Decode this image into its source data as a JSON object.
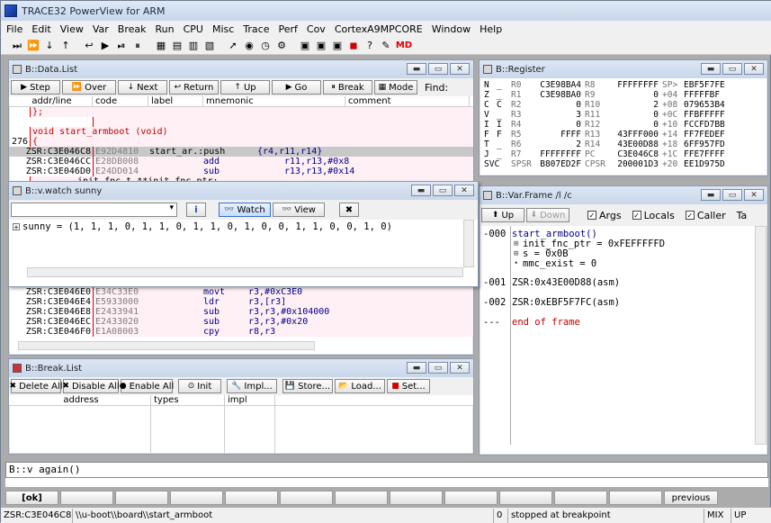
{
  "app": {
    "title": "TRACE32 PowerView for ARM"
  },
  "menu": [
    "File",
    "Edit",
    "View",
    "Var",
    "Break",
    "Run",
    "CPU",
    "Misc",
    "Trace",
    "Perf",
    "Cov",
    "CortexA9MPCORE",
    "Window",
    "Help"
  ],
  "toolbar_icons": [
    "step-into-icon",
    "step-over-icon",
    "step-down-icon",
    "step-up-icon",
    "return-icon",
    "go-icon",
    "go-next-icon",
    "break-icon",
    "list-icon",
    "register-icon",
    "memory-icon",
    "display-icon",
    "arrow-icon",
    "stop-icon",
    "timer-icon",
    "gear-icon",
    "chip-icon",
    "chip2-icon",
    "chip3-icon",
    "cube-icon",
    "help-icon",
    "tools-icon",
    "md-icon"
  ],
  "toolbar_md": "MD",
  "datalist": {
    "title": "B::Data.List",
    "buttons": [
      "Step",
      "Over",
      "Next",
      "Return",
      "Up",
      "Go",
      "Break",
      "Mode"
    ],
    "find": "Find:",
    "headers": [
      "addr/line",
      "code",
      "label",
      "mnemonic",
      "comment"
    ],
    "rows_top": [
      {
        "a": "",
        "c": "",
        "l": "};",
        "m": "",
        "o": ""
      },
      {
        "a": "",
        "c": "",
        "l": "",
        "m": "",
        "o": ""
      },
      {
        "a": "",
        "c": "",
        "l": "void start_armboot (void)",
        "m": "",
        "o": ""
      },
      {
        "a": "276",
        "c": "",
        "l": "{",
        "m": "",
        "o": ""
      },
      {
        "a": "ZSR:C3E046C8",
        "c": "E92D4810",
        "l": "start_ar.:push",
        "m": "{r4,r11,r14}",
        "o": ""
      },
      {
        "a": "ZSR:C3E046CC",
        "c": "E28DB008",
        "l": "",
        "m": "add",
        "o": "r11,r13,#0x8"
      },
      {
        "a": "ZSR:C3E046D0",
        "c": "E24DD014",
        "l": "",
        "m": "sub",
        "o": "r13,r13,#0x14"
      },
      {
        "a": "",
        "c": "",
        "l": "init_fnc_t **init_fnc_ptr;",
        "m": "",
        "o": ""
      }
    ],
    "rows_bottom": [
      {
        "a": "ZSR:C3E046E0",
        "c": "E34C33E0",
        "m": "movt",
        "o": "r3,#0xC3E0"
      },
      {
        "a": "ZSR:C3E046E4",
        "c": "E5933000",
        "m": "ldr",
        "o": "r3,[r3]"
      },
      {
        "a": "ZSR:C3E046E8",
        "c": "E2433941",
        "m": "sub",
        "o": "r3,r3,#0x104000"
      },
      {
        "a": "ZSR:C3E046EC",
        "c": "E2433020",
        "m": "sub",
        "o": "r3,r3,#0x20"
      },
      {
        "a": "ZSR:C3E046F0",
        "c": "E1A08003",
        "m": "cpy",
        "o": "r8,r3"
      }
    ]
  },
  "watch": {
    "title": "B::v.watch sunny",
    "buttons": [
      "Watch",
      "View"
    ],
    "line": "sunny = (1, 1, 1, 0, 1, 1, 0, 1, 1, 0, 1, 0, 0, 1, 1, 0, 0, 1, 0)"
  },
  "register": {
    "title": "B::Register",
    "rows": [
      [
        "N",
        "_",
        "R0",
        "C3E98BA4",
        "R8",
        "FFFFFFFF",
        "SP>",
        "EBF5F7FE"
      ],
      [
        "Z",
        "_",
        "R1",
        "C3E98BA0",
        "R9",
        "0",
        "+04",
        "FFFFFBF"
      ],
      [
        "C",
        "C",
        "R2",
        "0",
        "R10",
        "2",
        "+08",
        "079653B4"
      ],
      [
        "V",
        "_",
        "R3",
        "3",
        "R11",
        "0",
        "+0C",
        "FFBFFFFF"
      ],
      [
        "I",
        "I",
        "R4",
        "0",
        "R12",
        "0",
        "+10",
        "FCCFD7BB"
      ],
      [
        "F",
        "F",
        "R5",
        "FFFF",
        "R13",
        "43FFF000",
        "+14",
        "FF7FEDEF"
      ],
      [
        "T",
        "_",
        "R6",
        "2",
        "R14",
        "43E00D88",
        "+18",
        "6FF957FD"
      ],
      [
        "J",
        "_",
        "R7",
        "FFFFFFFF",
        "PC",
        "C3E046C8",
        "+1C",
        "FFE7FFFF"
      ],
      [
        "SVC",
        "",
        "SPSR",
        "B807ED2F",
        "CPSR",
        "200001D3",
        "+20",
        "EE1D975D"
      ]
    ]
  },
  "varframe": {
    "title": "B::Var.Frame /l /c",
    "buttons": [
      "Up",
      "Down"
    ],
    "checks": [
      "Args",
      "Locals",
      "Caller"
    ],
    "extra": "Ta",
    "frames": [
      {
        "n": "-000",
        "lines": [
          "start_armboot()",
          "init_fnc_ptr = 0xFEFFFFFD",
          "s = 0x0B",
          "mmc_exist = 0"
        ]
      },
      {
        "n": "-001",
        "lines": [
          "ZSR:0x43E00D88(asm)"
        ]
      },
      {
        "n": "-002",
        "lines": [
          "ZSR:0xEBF5F7FC(asm)"
        ]
      },
      {
        "n": "---",
        "lines": [
          "end of frame"
        ]
      }
    ]
  },
  "breaklist": {
    "title": "B::Break.List",
    "buttons": [
      "Delete All",
      "Disable All",
      "Enable All",
      "Init",
      "Impl...",
      "Store...",
      "Load...",
      "Set..."
    ],
    "headers": [
      "address",
      "types",
      "impl"
    ]
  },
  "command": {
    "text": "B::v again()"
  },
  "softkeys": [
    "[ok]",
    "",
    "",
    "",
    "",
    "",
    "",
    "",
    "",
    "",
    "",
    "",
    "previous"
  ],
  "status": {
    "address": "ZSR:C3E046C8",
    "path": "\\\\u-boot\\\\board\\\\start_armboot",
    "num": "0",
    "state": "stopped at breakpoint",
    "mode": "MIX",
    "dir": "UP"
  }
}
